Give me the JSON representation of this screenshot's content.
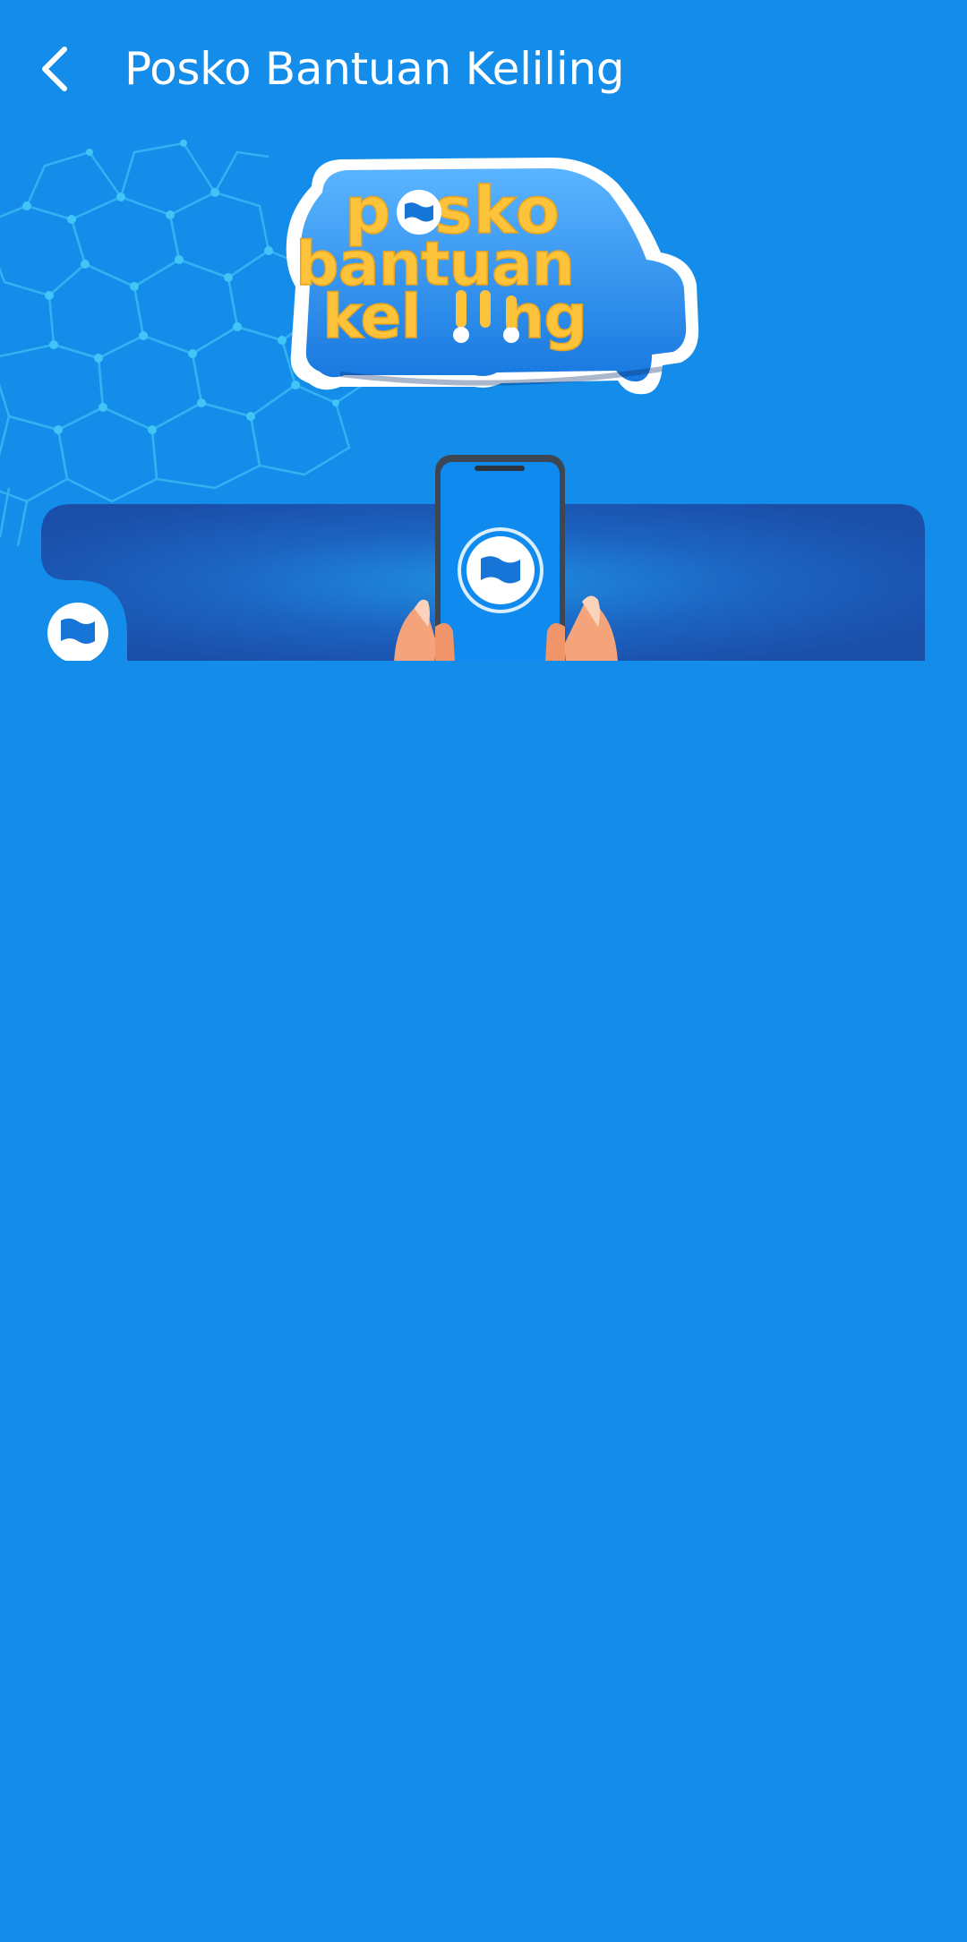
{
  "header": {
    "title": "Posko Bantuan Keliling",
    "back_icon": "chevron-left-icon"
  },
  "banner": {
    "logo_lines": [
      "posko",
      "bantuan",
      "keliling"
    ],
    "logo_color": "#fdc33b",
    "panel_color": "#1a4ea8",
    "phone_screen_color": "#0f8bf0",
    "brand_icon": "flag-icon"
  },
  "colors": {
    "background": "#138de9",
    "title_text": "#ffffff",
    "hex_lines": "#3ab8f5"
  }
}
